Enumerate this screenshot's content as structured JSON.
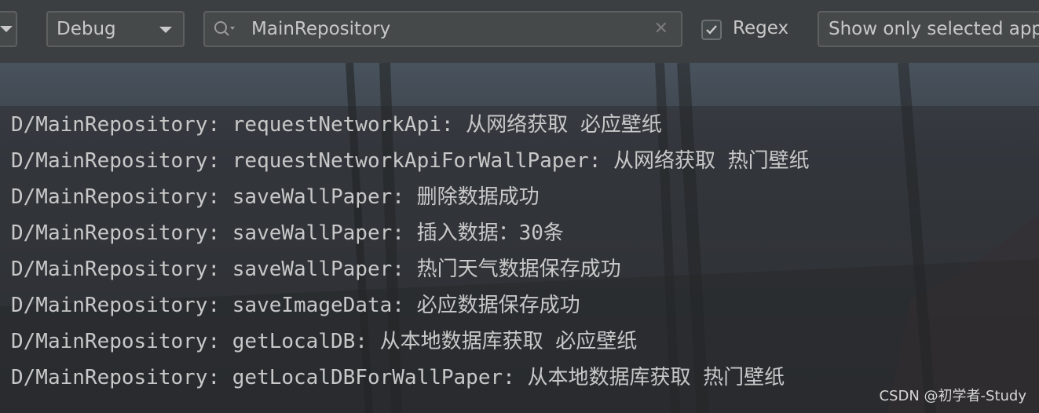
{
  "toolbar": {
    "level_select": {
      "value": "Debug"
    },
    "search": {
      "value": "MainRepository"
    },
    "regex": {
      "label": "Regex",
      "checked": true
    },
    "app_filter": {
      "value": "Show only selected app"
    }
  },
  "log": {
    "lines": [
      {
        "tag": "D/MainRepository:",
        "message": "requestNetworkApi: 从网络获取 必应壁纸"
      },
      {
        "tag": "D/MainRepository:",
        "message": "requestNetworkApiForWallPaper: 从网络获取 热门壁纸"
      },
      {
        "tag": "D/MainRepository:",
        "message": "saveWallPaper: 删除数据成功"
      },
      {
        "tag": "D/MainRepository:",
        "message": "saveWallPaper: 插入数据：30条"
      },
      {
        "tag": "D/MainRepository:",
        "message": "saveWallPaper: 热门天气数据保存成功"
      },
      {
        "tag": "D/MainRepository:",
        "message": "saveImageData: 必应数据保存成功"
      },
      {
        "tag": "D/MainRepository:",
        "message": "getLocalDB: 从本地数据库获取 必应壁纸"
      },
      {
        "tag": "D/MainRepository:",
        "message": "getLocalDBForWallPaper: 从本地数据库获取 热门壁纸"
      }
    ]
  },
  "watermark": "CSDN @初学者-Study",
  "colors": {
    "toolbar_bg": "#3c3f41",
    "field_bg": "#45494a",
    "log_text": "#c8c8c8"
  },
  "icons": {
    "search": "search-icon",
    "clear": "close-icon",
    "check": "check-icon",
    "dropdown": "chevron-down-icon"
  }
}
